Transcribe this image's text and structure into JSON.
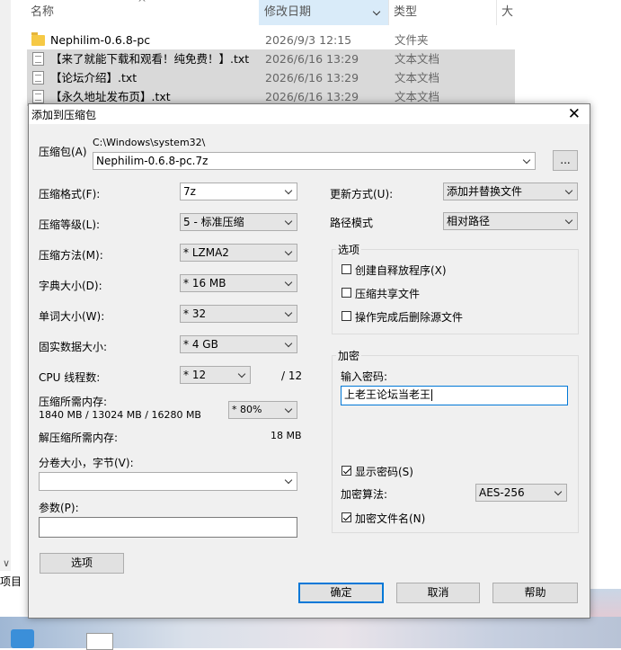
{
  "explorer": {
    "columns": {
      "name": "名称",
      "date": "修改日期",
      "type": "类型",
      "size": "大"
    },
    "files": [
      {
        "name": "Nephilim-0.6.8-pc",
        "date": "2026/9/3 12:15",
        "type": "文件夹",
        "icon": "folder-icon"
      },
      {
        "name": "【来了就能下载和观看！纯免费！】.txt",
        "date": "2026/6/16 13:29",
        "type": "文本文档",
        "icon": "text-file-icon"
      },
      {
        "name": "【论坛介绍】.txt",
        "date": "2026/6/16 13:29",
        "type": "文本文档",
        "icon": "text-file-icon"
      },
      {
        "name": "【永久地址发布页】.txt",
        "date": "2026/6/16 13:29",
        "type": "文本文档",
        "icon": "text-file-icon"
      }
    ],
    "status_left": "项目"
  },
  "dialog": {
    "title": "添加到压缩包",
    "archive": {
      "label": "压缩包(A)",
      "path": "C:\\Windows\\system32\\",
      "name": "Nephilim-0.6.8-pc.7z",
      "browse_label": "..."
    },
    "format": {
      "label": "压缩格式(F):",
      "value": "7z"
    },
    "level": {
      "label": "压缩等级(L):",
      "value": "5 - 标准压缩"
    },
    "method": {
      "label": "压缩方法(M):",
      "value": "* LZMA2"
    },
    "dict": {
      "label": "字典大小(D):",
      "value": "* 16 MB"
    },
    "word": {
      "label": "单词大小(W):",
      "value": "* 32"
    },
    "solid": {
      "label": "固实数据大小:",
      "value": "* 4 GB"
    },
    "threads": {
      "label": "CPU 线程数:",
      "value": "* 12",
      "max": "/ 12"
    },
    "mem_compress": {
      "label": "压缩所需内存:",
      "value": "1840 MB / 13024 MB / 16280 MB",
      "percent": "* 80%"
    },
    "mem_decompress": {
      "label": "解压缩所需内存:",
      "value": "18 MB"
    },
    "volume": {
      "label": "分卷大小，字节(V):",
      "value": ""
    },
    "params": {
      "label": "参数(P):",
      "value": ""
    },
    "options_button": "选项",
    "update_mode": {
      "label": "更新方式(U):",
      "value": "添加并替换文件"
    },
    "path_mode": {
      "label": "路径模式",
      "value": "相对路径"
    },
    "options_group": {
      "label": "选项",
      "sfx": "创建自释放程序(X)",
      "shared": "压缩共享文件",
      "delete": "操作完成后删除源文件"
    },
    "encryption": {
      "label": "加密",
      "password_label": "输入密码:",
      "password": "上老王论坛当老王",
      "show_password": "显示密码(S)",
      "method_label": "加密算法:",
      "method": "AES-256",
      "encrypt_names": "加密文件名(N)"
    },
    "buttons": {
      "ok": "确定",
      "cancel": "取消",
      "help": "帮助"
    }
  }
}
